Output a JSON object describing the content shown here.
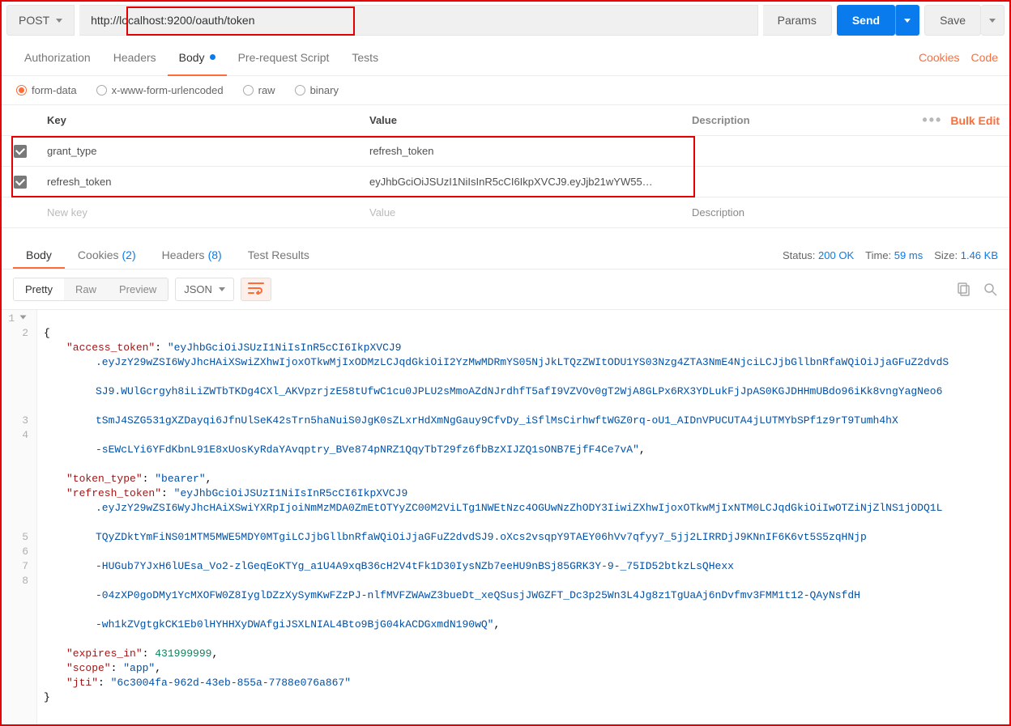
{
  "request": {
    "method": "POST",
    "url": "http://localhost:9200/oauth/token",
    "buttons": {
      "params": "Params",
      "send": "Send",
      "save": "Save"
    }
  },
  "request_tabs": {
    "authorization": "Authorization",
    "headers": "Headers",
    "body": "Body",
    "prerequest": "Pre-request Script",
    "tests": "Tests",
    "cookies_link": "Cookies",
    "code_link": "Code"
  },
  "body_types": {
    "form_data": "form-data",
    "urlencoded": "x-www-form-urlencoded",
    "raw": "raw",
    "binary": "binary"
  },
  "kv_headers": {
    "key": "Key",
    "value": "Value",
    "description": "Description",
    "bulk_edit": "Bulk Edit"
  },
  "kv_rows": [
    {
      "enabled": true,
      "key": "grant_type",
      "value": "refresh_token"
    },
    {
      "enabled": true,
      "key": "refresh_token",
      "value": "eyJhbGciOiJSUzI1NiIsInR5cCI6IkpXVCJ9.eyJjb21wYW55…"
    }
  ],
  "kv_placeholder": {
    "key": "New key",
    "value": "Value",
    "description": "Description"
  },
  "response_tabs": {
    "body": "Body",
    "cookies": "Cookies",
    "cookies_count": "(2)",
    "headers": "Headers",
    "headers_count": "(8)",
    "test_results": "Test Results"
  },
  "response_meta": {
    "status_label": "Status:",
    "status_value": "200 OK",
    "time_label": "Time:",
    "time_value": "59 ms",
    "size_label": "Size:",
    "size_value": "1.46 KB"
  },
  "response_toolbar": {
    "pretty": "Pretty",
    "raw": "Raw",
    "preview": "Preview",
    "format": "JSON"
  },
  "json_body": {
    "line1": "{",
    "access_token_key": "\"access_token\"",
    "access_token_val_line0": "\"eyJhbGciOiJSUzI1NiIsInR5cCI6IkpXVCJ9",
    "access_token_val_line1": ".eyJzY29wZSI6WyJhcHAiXSwiZXhwIjoxOTkwMjIxODMzLCJqdGkiOiI2YzMwMDRmYS05NjJkLTQzZWItODU1YS03Nzg4ZTA3NmE4NjciLCJjbGllbnRfaWQiOiJjaGFuZ2dvdS",
    "access_token_val_line2": "SJ9.WUlGcrgyh8iLiZWTbTKDg4CXl_AKVpzrjzE58tUfwC1cu0JPLU2sMmoAZdNJrdhfT5afI9VZVOv0gT2WjA8GLPx6RX3YDLukFjJpAS0KGJDHHmUBdo96iKk8vngYagNeo6",
    "access_token_val_line3": "tSmJ4SZG531gXZDayqi6JfnUlSeK42sTrn5haNuiS0JgK0sZLxrHdXmNgGauy9CfvDy_iSflMsCirhwftWGZ0rq-oU1_AIDnVPUCUTA4jLUTMYbSPf1z9rT9Tumh4hX",
    "access_token_val_line4": "-sEWcLYi6YFdKbnL91E8xUosKyRdaYAvqptry_BVe874pNRZ1QqyTbT29fz6fbBzXIJZQ1sONB7EjfF4Ce7vA\"",
    "token_type_key": "\"token_type\"",
    "token_type_val": "\"bearer\"",
    "refresh_token_key": "\"refresh_token\"",
    "refresh_token_val_line0": "\"eyJhbGciOiJSUzI1NiIsInR5cCI6IkpXVCJ9",
    "refresh_token_val_line1": ".eyJzY29wZSI6WyJhcHAiXSwiYXRpIjoiNmMzMDA0ZmEtOTYyZC00M2ViLTg1NWEtNzc4OGUwNzZhODY3IiwiZXhwIjoxOTkwMjIxNTM0LCJqdGkiOiIwOTZiNjZlNS1jODQ1L",
    "refresh_token_val_line2": "TQyZDktYmFiNS01MTM5MWE5MDY0MTgiLCJjbGllbnRfaWQiOiJjaGFuZ2dvdSJ9.oXcs2vsqpY9TAEY06hVv7qfyy7_5jj2LIRRDjJ9KNnIF6K6vt5S5zqHNjp",
    "refresh_token_val_line3": "-HUGub7YJxH6lUEsa_Vo2-zlGeqEoKTYg_a1U4A9xqB36cH2V4tFk1D30IysNZb7eeHU9nBSj85GRK3Y-9-_75ID52btkzLsQHexx",
    "refresh_token_val_line4": "-04zXP0goDMy1YcMXOFW0Z8IyglDZzXySymKwFZzPJ-nlfMVFZWAwZ3bueDt_xeQSusjJWGZFT_Dc3p25Wn3L4Jg8z1TgUaAj6nDvfmv3FMM1t12-QAyNsfdH",
    "refresh_token_val_line5": "-wh1kZVgtgkCK1Eb0lHYHHXyDWAfgiJSXLNIAL4Bto9BjG04kACDGxmdN190wQ\"",
    "expires_in_key": "\"expires_in\"",
    "expires_in_val": "431999999",
    "scope_key": "\"scope\"",
    "scope_val": "\"app\"",
    "jti_key": "\"jti\"",
    "jti_val": "\"6c3004fa-962d-43eb-855a-7788e076a867\"",
    "line_end": "}"
  }
}
